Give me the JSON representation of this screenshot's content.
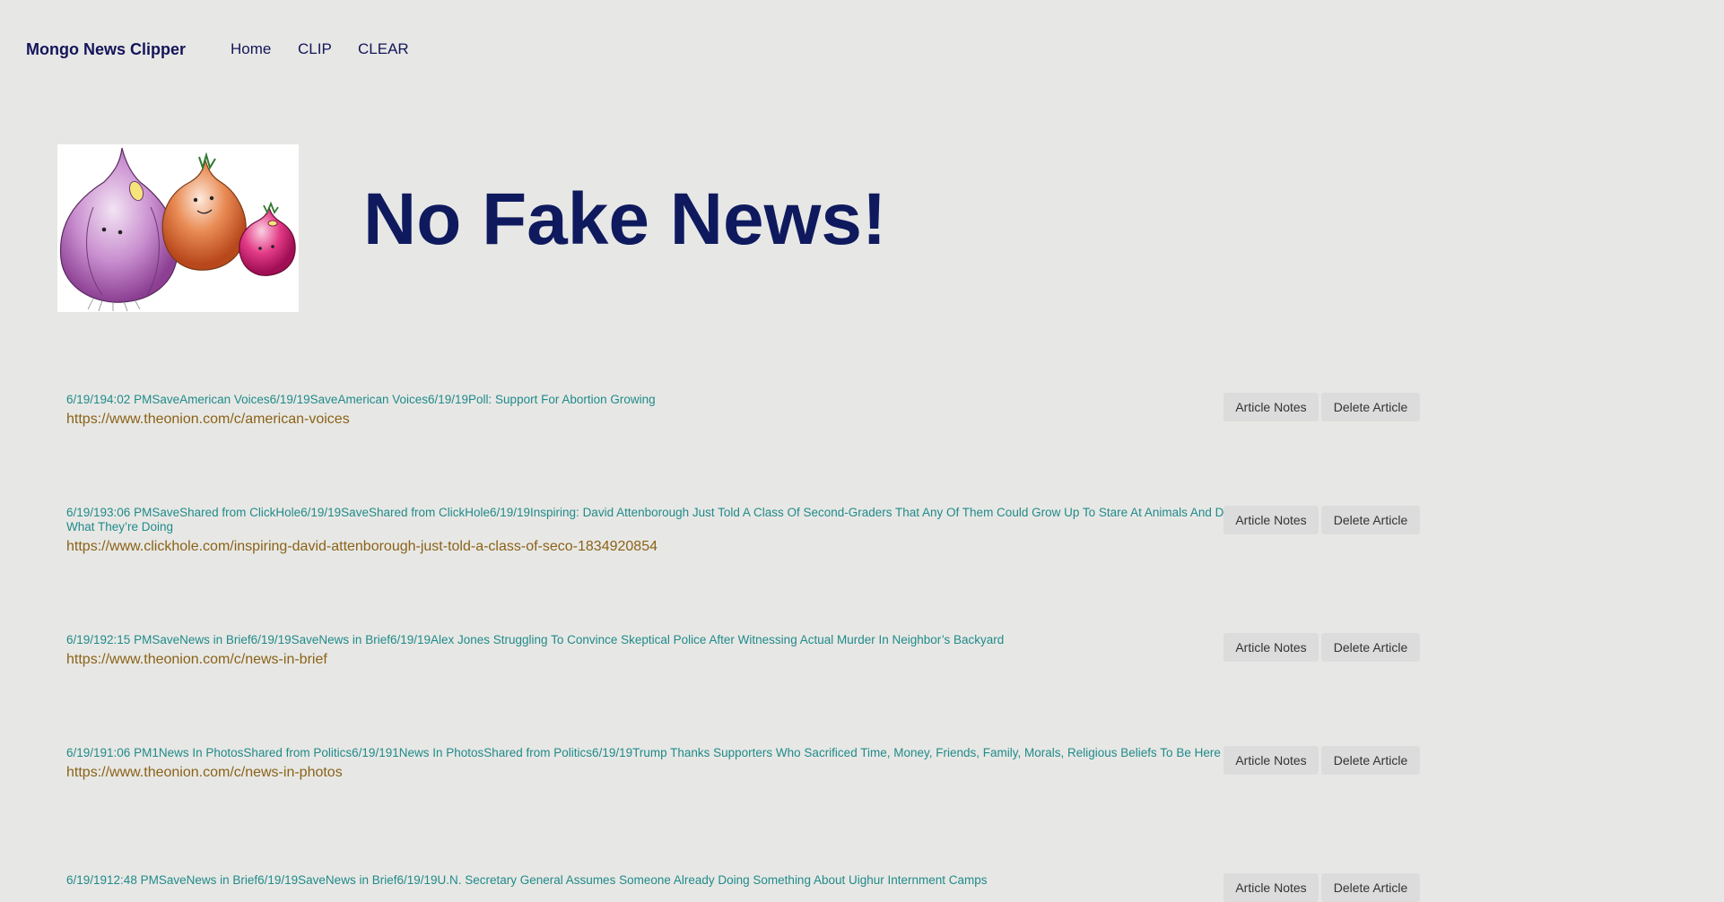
{
  "nav": {
    "brand": "Mongo News Clipper",
    "links": [
      "Home",
      "CLIP",
      "CLEAR"
    ]
  },
  "hero": {
    "image": "onions-illustration",
    "title": "No Fake News!"
  },
  "buttons": {
    "notes": "Article Notes",
    "delete": "Delete Article"
  },
  "articles": [
    {
      "headline": "6/19/194:02 PMSaveAmerican Voices6/19/19SaveAmerican Voices6/19/19Poll: Support For Abortion Growing",
      "link": "https://www.theonion.com/c/american-voices"
    },
    {
      "headline": "6/19/193:06 PMSaveShared from ClickHole6/19/19SaveShared from ClickHole6/19/19Inspiring: David Attenborough Just Told A Class Of Second-Graders That Any Of Them Could Grow Up To Stare At Animals And Describe What They’re Doing",
      "link": "https://www.clickhole.com/inspiring-david-attenborough-just-told-a-class-of-seco-1834920854"
    },
    {
      "headline": "6/19/192:15 PMSaveNews in Brief6/19/19SaveNews in Brief6/19/19Alex Jones Struggling To Convince Skeptical Police After Witnessing Actual Murder In Neighbor’s Backyard",
      "link": "https://www.theonion.com/c/news-in-brief"
    },
    {
      "headline": "6/19/191:06 PM1News In PhotosShared from Politics6/19/191News In PhotosShared from Politics6/19/19Trump Thanks Supporters Who Sacrificed Time, Money, Friends, Family, Morals, Religious Beliefs To Be Here Today",
      "link": "https://www.theonion.com/c/news-in-photos"
    },
    {
      "headline": "6/19/1912:48 PMSaveNews in Brief6/19/19SaveNews in Brief6/19/19U.N. Secretary General Assumes Someone Already Doing Something About Uighur Internment Camps",
      "link": ""
    }
  ]
}
